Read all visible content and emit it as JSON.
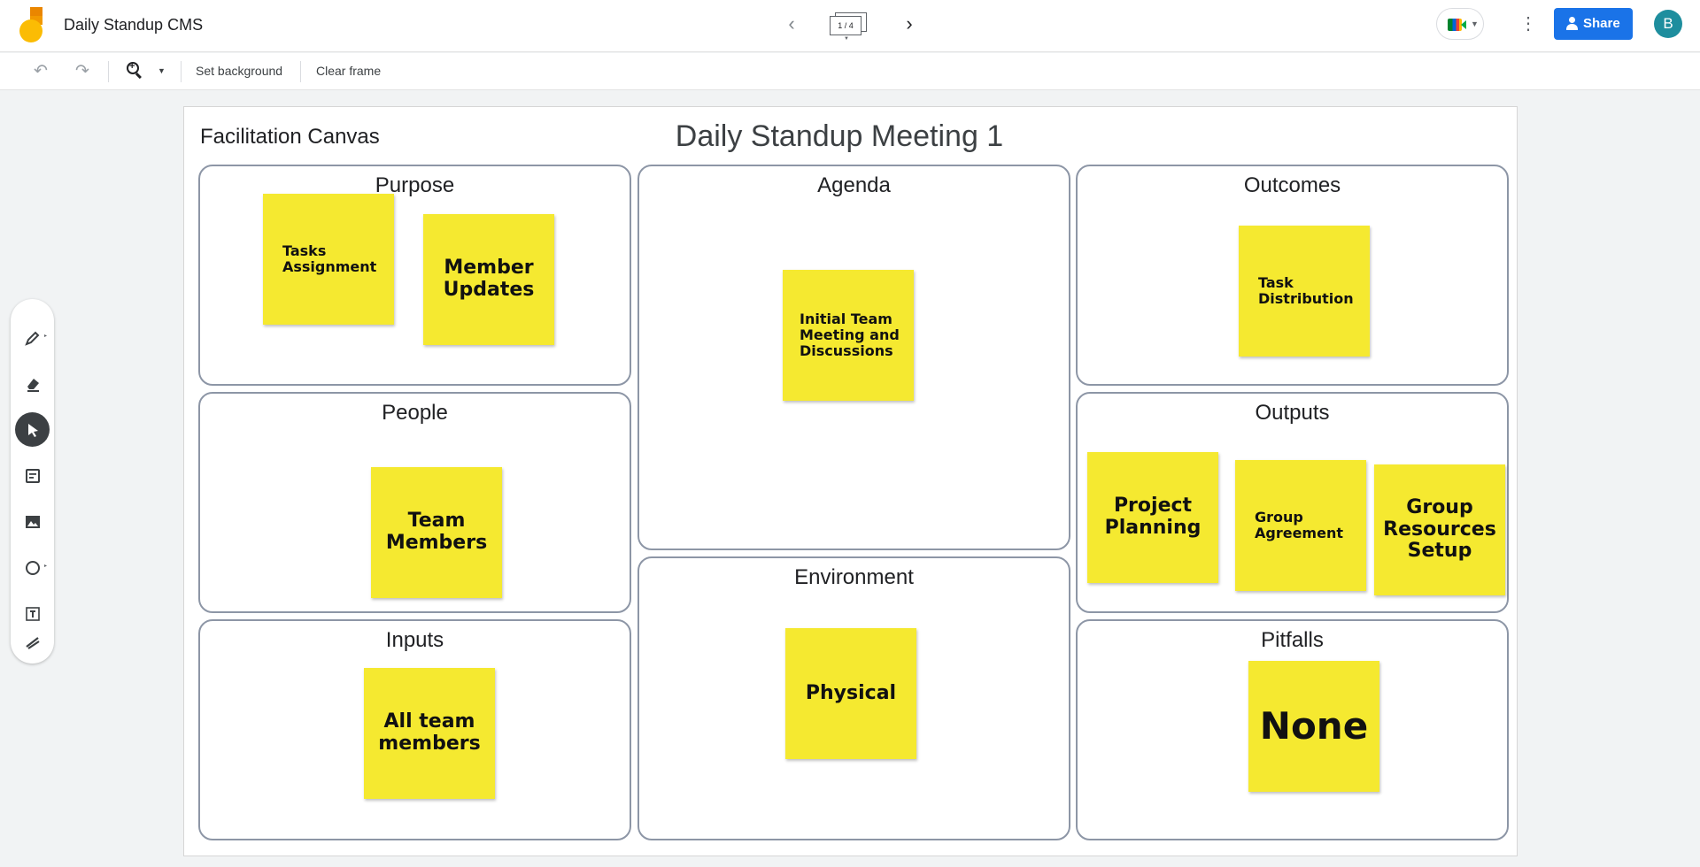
{
  "app": {
    "title": "Daily Standup CMS",
    "frame_indicator": "1 / 4",
    "share_label": "Share",
    "avatar_initial": "B",
    "more_icon": "⋮"
  },
  "toolbar": {
    "set_background": "Set background",
    "clear_frame": "Clear frame"
  },
  "canvas": {
    "label": "Facilitation Canvas",
    "title": "Daily Standup Meeting 1",
    "sections": {
      "purpose": "Purpose",
      "agenda": "Agenda",
      "outcomes": "Outcomes",
      "people": "People",
      "outputs": "Outputs",
      "environment": "Environment",
      "inputs": "Inputs",
      "pitfalls": "Pitfalls"
    },
    "notes": {
      "tasks_assignment": "Tasks Assignment",
      "member_updates": "Member Updates",
      "initial_team_meeting": "Initial Team Meeting and Discussions",
      "task_distribution": "Task Distribution",
      "team_members": "Team Members",
      "project_planning": "Project Planning",
      "group_agreement": "Group Agreement",
      "group_resources_setup": "Group Resources Setup",
      "physical": "Physical",
      "all_team_members": "All team members",
      "none": "None"
    },
    "note_color": "#f5e930"
  },
  "colors": {
    "share_blue": "#1a73e8",
    "avatar_teal": "#1e8e9e",
    "box_border": "#8d96a6"
  }
}
